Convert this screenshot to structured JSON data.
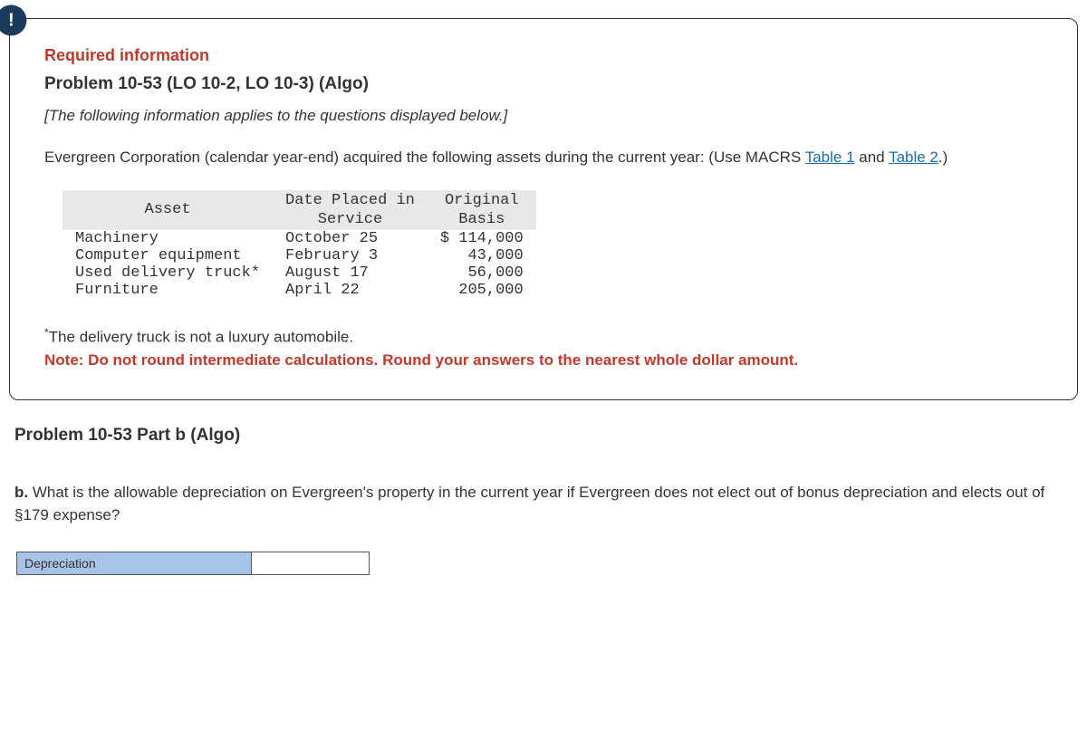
{
  "badge": "!",
  "required_info": "Required information",
  "problem_title": "Problem 10-53 (LO 10-2, LO 10-3) (Algo)",
  "subtitle": "[The following information applies to the questions displayed below.]",
  "body_text_pre": "Evergreen Corporation (calendar year-end) acquired the following assets during the current year: (Use MACRS ",
  "link1": "Table 1",
  "body_text_mid": " and ",
  "link2": "Table 2",
  "body_text_post": ".)",
  "table": {
    "headers": {
      "asset": "Asset",
      "date": "Date Placed in\nService",
      "basis": "Original\nBasis"
    },
    "rows": [
      {
        "asset": "Machinery",
        "date": "October 25",
        "basis": "$ 114,000"
      },
      {
        "asset": "Computer equipment",
        "date": "February 3",
        "basis": "43,000"
      },
      {
        "asset": "Used delivery truck*",
        "date": "August 17",
        "basis": "56,000"
      },
      {
        "asset": "Furniture",
        "date": "April 22",
        "basis": "205,000"
      }
    ]
  },
  "footnote_star": "*",
  "footnote_text": "The delivery truck is not a luxury automobile.",
  "note": "Note: Do not round intermediate calculations. Round your answers to the nearest whole dollar amount.",
  "part_title": "Problem 10-53 Part b (Algo)",
  "question_prefix": "b. ",
  "question_text": "What is the allowable depreciation on Evergreen's property in the current year if Evergreen does not elect out of bonus depreciation and elects out of §179 expense?",
  "answer_label": "Depreciation",
  "answer_value": ""
}
